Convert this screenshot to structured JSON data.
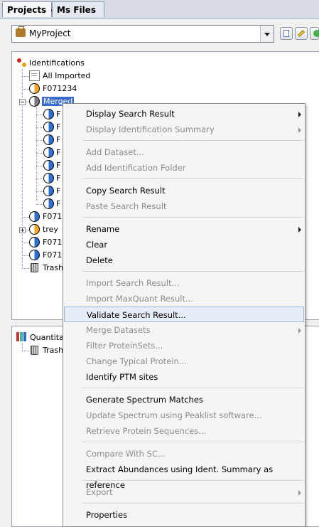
{
  "tabs": [
    {
      "label": "Projects",
      "close": "⊗"
    },
    {
      "label": "Ms Files"
    }
  ],
  "project_select": {
    "value": "MyProject"
  },
  "toolbar_icons": [
    "new-icon",
    "edit-icon",
    "add-icon"
  ],
  "tree": {
    "root": "Identifications",
    "all_imported": "All Imported",
    "f071234": "F071234",
    "merged": "Merged",
    "merged_children": [
      "F",
      "F",
      "F",
      "F",
      "F",
      "F",
      "F",
      "F"
    ],
    "f0712_a": "F0712",
    "trey": "trey",
    "f0712_b": "F0712",
    "f0712_c": "F0712",
    "trash": "Trash"
  },
  "tree2": {
    "root": "Quantitat",
    "trash": "Trash"
  },
  "context_menu": {
    "items": [
      {
        "label": "Display Search Result",
        "enabled": true,
        "submenu": true
      },
      {
        "label": "Display Identification Summary",
        "enabled": false,
        "submenu": true
      },
      {
        "label": "Add Dataset...",
        "enabled": false
      },
      {
        "label": "Add Identification Folder",
        "enabled": false
      },
      {
        "label": "Copy Search Result",
        "enabled": true
      },
      {
        "label": "Paste Search Result",
        "enabled": false
      },
      {
        "label": "Rename",
        "enabled": true,
        "submenu": true
      },
      {
        "label": "Clear",
        "enabled": true
      },
      {
        "label": "Delete",
        "enabled": true
      },
      {
        "label": "Import Search Result...",
        "enabled": false
      },
      {
        "label": "Import MaxQuant Result...",
        "enabled": false
      },
      {
        "label": "Validate Search Result...",
        "enabled": true,
        "highlighted": true
      },
      {
        "label": "Merge Datasets",
        "enabled": false,
        "submenu": true
      },
      {
        "label": "Filter ProteinSets...",
        "enabled": false
      },
      {
        "label": "Change Typical Protein...",
        "enabled": false
      },
      {
        "label": "Identify PTM sites",
        "enabled": true
      },
      {
        "label": "Generate Spectrum Matches",
        "enabled": true
      },
      {
        "label": "Update Spectrum using Peaklist software...",
        "enabled": false
      },
      {
        "label": "Retrieve Protein Sequences...",
        "enabled": false
      },
      {
        "label": "Compare With SC...",
        "enabled": false
      },
      {
        "label": "Extract Abundances using Ident. Summary as reference",
        "enabled": true
      },
      {
        "label": "Export",
        "enabled": false,
        "submenu": true
      },
      {
        "label": "Properties",
        "enabled": true
      }
    ]
  },
  "colors": {
    "selection": "#3b6cc8",
    "highlight_border": "#9bb3d8",
    "disabled_text": "#8c8c8c"
  }
}
